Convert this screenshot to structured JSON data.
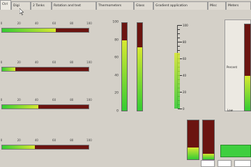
{
  "tabs": [
    {
      "label": "Ctrl",
      "active": true
    },
    {
      "label": "Digi"
    },
    {
      "label": "2 Tanks"
    },
    {
      "label": "Rotation and text"
    },
    {
      "label": "Thermometers"
    },
    {
      "label": "Glass"
    },
    {
      "label": "Gradient application"
    },
    {
      "label": "Misc"
    },
    {
      "label": "Meters"
    }
  ],
  "horizontal_gauges": {
    "scale_ticks": [
      "0",
      "20",
      "40",
      "60",
      "80",
      "100"
    ],
    "gauges": [
      {
        "value": 0.62
      },
      {
        "value": 0.15
      },
      {
        "value": 0.42
      },
      {
        "value": 0.38
      }
    ]
  },
  "vertical_gauges": {
    "scale_ticks": [
      "100",
      "80",
      "60",
      "40",
      "20",
      "0"
    ],
    "gauges": [
      {
        "value": 0.8
      },
      {
        "value": 0.72
      }
    ]
  },
  "ruler": {
    "ticks": [
      "100",
      "80",
      "60",
      "40",
      "20",
      "0"
    ]
  },
  "right_panel": {
    "side_label": "Percent",
    "bottom_label": "Low"
  },
  "mini_bars": {
    "values": [
      0.3,
      0.15
    ]
  },
  "colors": {
    "background": "#d4d0c8",
    "bar_empty": "#6b1410",
    "fill_low": "#33cc33",
    "fill_high": "#d8e830"
  }
}
